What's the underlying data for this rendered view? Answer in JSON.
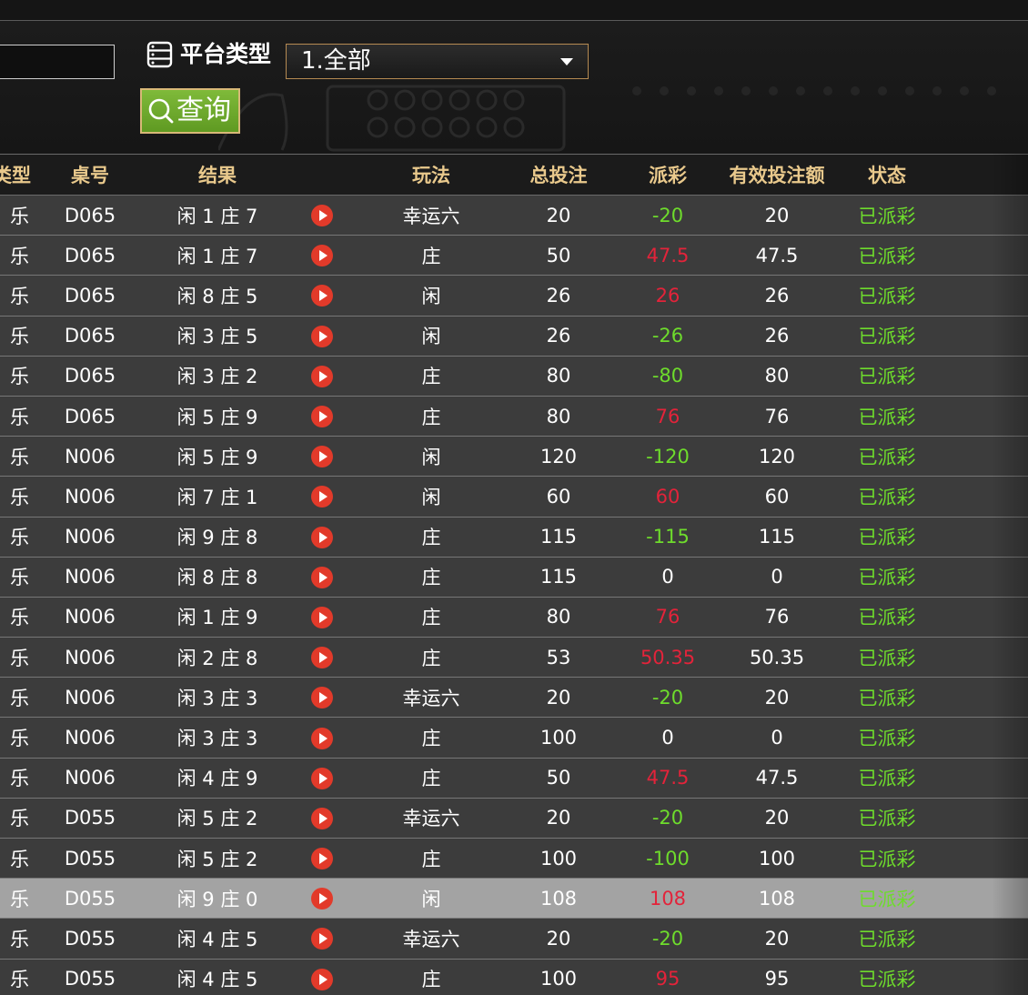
{
  "filter": {
    "date_input_value": "",
    "platform_label": "平台类型",
    "platform_selected": "1.全部",
    "query_button_label": "查询"
  },
  "table": {
    "headers": {
      "type": "类型",
      "table_no": "桌号",
      "result": "结果",
      "video": "",
      "play": "玩法",
      "total_bet": "总投注",
      "payout": "派彩",
      "valid_bet": "有效投注额",
      "status": "状态"
    },
    "rows": [
      {
        "type": "乐",
        "table_no": "D065",
        "result": "闲 1 庄 7",
        "play": "幸运六",
        "total_bet": "20",
        "payout": "-20",
        "valid_bet": "20",
        "status": "已派彩"
      },
      {
        "type": "乐",
        "table_no": "D065",
        "result": "闲 1 庄 7",
        "play": "庄",
        "total_bet": "50",
        "payout": "47.5",
        "valid_bet": "47.5",
        "status": "已派彩"
      },
      {
        "type": "乐",
        "table_no": "D065",
        "result": "闲 8 庄 5",
        "play": "闲",
        "total_bet": "26",
        "payout": "26",
        "valid_bet": "26",
        "status": "已派彩"
      },
      {
        "type": "乐",
        "table_no": "D065",
        "result": "闲 3 庄 5",
        "play": "闲",
        "total_bet": "26",
        "payout": "-26",
        "valid_bet": "26",
        "status": "已派彩"
      },
      {
        "type": "乐",
        "table_no": "D065",
        "result": "闲 3 庄 2",
        "play": "庄",
        "total_bet": "80",
        "payout": "-80",
        "valid_bet": "80",
        "status": "已派彩"
      },
      {
        "type": "乐",
        "table_no": "D065",
        "result": "闲 5 庄 9",
        "play": "庄",
        "total_bet": "80",
        "payout": "76",
        "valid_bet": "76",
        "status": "已派彩"
      },
      {
        "type": "乐",
        "table_no": "N006",
        "result": "闲 5 庄 9",
        "play": "闲",
        "total_bet": "120",
        "payout": "-120",
        "valid_bet": "120",
        "status": "已派彩"
      },
      {
        "type": "乐",
        "table_no": "N006",
        "result": "闲 7 庄 1",
        "play": "闲",
        "total_bet": "60",
        "payout": "60",
        "valid_bet": "60",
        "status": "已派彩"
      },
      {
        "type": "乐",
        "table_no": "N006",
        "result": "闲 9 庄 8",
        "play": "庄",
        "total_bet": "115",
        "payout": "-115",
        "valid_bet": "115",
        "status": "已派彩"
      },
      {
        "type": "乐",
        "table_no": "N006",
        "result": "闲 8 庄 8",
        "play": "庄",
        "total_bet": "115",
        "payout": "0",
        "valid_bet": "0",
        "status": "已派彩"
      },
      {
        "type": "乐",
        "table_no": "N006",
        "result": "闲 1 庄 9",
        "play": "庄",
        "total_bet": "80",
        "payout": "76",
        "valid_bet": "76",
        "status": "已派彩"
      },
      {
        "type": "乐",
        "table_no": "N006",
        "result": "闲 2 庄 8",
        "play": "庄",
        "total_bet": "53",
        "payout": "50.35",
        "valid_bet": "50.35",
        "status": "已派彩"
      },
      {
        "type": "乐",
        "table_no": "N006",
        "result": "闲 3 庄 3",
        "play": "幸运六",
        "total_bet": "20",
        "payout": "-20",
        "valid_bet": "20",
        "status": "已派彩"
      },
      {
        "type": "乐",
        "table_no": "N006",
        "result": "闲 3 庄 3",
        "play": "庄",
        "total_bet": "100",
        "payout": "0",
        "valid_bet": "0",
        "status": "已派彩"
      },
      {
        "type": "乐",
        "table_no": "N006",
        "result": "闲 4 庄 9",
        "play": "庄",
        "total_bet": "50",
        "payout": "47.5",
        "valid_bet": "47.5",
        "status": "已派彩"
      },
      {
        "type": "乐",
        "table_no": "D055",
        "result": "闲 5 庄 2",
        "play": "幸运六",
        "total_bet": "20",
        "payout": "-20",
        "valid_bet": "20",
        "status": "已派彩"
      },
      {
        "type": "乐",
        "table_no": "D055",
        "result": "闲 5 庄 2",
        "play": "庄",
        "total_bet": "100",
        "payout": "-100",
        "valid_bet": "100",
        "status": "已派彩"
      },
      {
        "type": "乐",
        "table_no": "D055",
        "result": "闲 9 庄 0",
        "play": "闲",
        "total_bet": "108",
        "payout": "108",
        "valid_bet": "108",
        "status": "已派彩",
        "highlighted": true
      },
      {
        "type": "乐",
        "table_no": "D055",
        "result": "闲 4 庄 5",
        "play": "幸运六",
        "total_bet": "20",
        "payout": "-20",
        "valid_bet": "20",
        "status": "已派彩"
      },
      {
        "type": "乐",
        "table_no": "D055",
        "result": "闲 4 庄 5",
        "play": "庄",
        "total_bet": "100",
        "payout": "95",
        "valid_bet": "95",
        "status": "已派彩"
      }
    ]
  },
  "colors": {
    "header_text": "#e9c98c",
    "win_payout": "#e3233a",
    "loss_payout": "#6edc2c",
    "status_text": "#6edc2c",
    "query_button": "#6aa82b",
    "play_icon": "#e23a2a"
  },
  "icons": {
    "platform": "server-list-icon",
    "query": "search-icon",
    "row_action": "play-video-icon",
    "select": "chevron-down-icon"
  }
}
